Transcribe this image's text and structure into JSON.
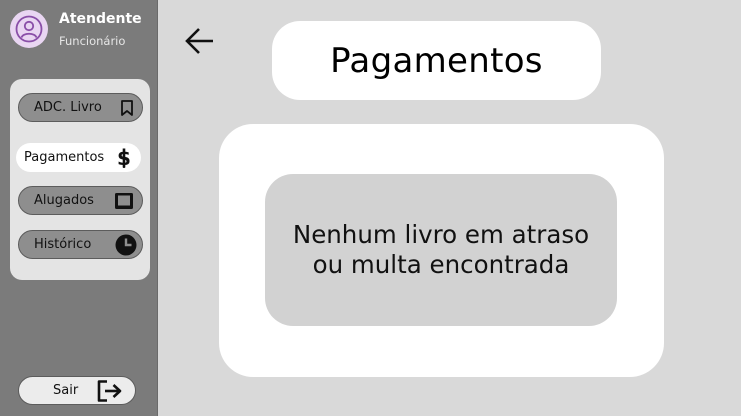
{
  "user": {
    "name": "Atendente",
    "role": "Funcionário",
    "avatar_icon": "user-icon"
  },
  "menu": {
    "items": [
      {
        "label": "ADC. Livro",
        "icon": "bookmark-icon",
        "active": false
      },
      {
        "label": "Pagamentos",
        "icon": "dollar-icon",
        "active": true
      },
      {
        "label": "Alugados",
        "icon": "book-icon",
        "active": false
      },
      {
        "label": "Histórico",
        "icon": "clock-icon",
        "active": false
      }
    ]
  },
  "logout": {
    "label": "Sair",
    "icon": "logout-icon"
  },
  "header": {
    "back_icon": "arrow-left-icon",
    "title": "Pagamentos"
  },
  "content": {
    "empty_line_1": "Nenhum livro em atraso",
    "empty_line_2": "ou multa encontrada"
  },
  "colors": {
    "sidebar": "#7b7b7b",
    "background": "#d9d9d9",
    "avatar": "#e9d6f2",
    "active_item": "#ffffff"
  }
}
